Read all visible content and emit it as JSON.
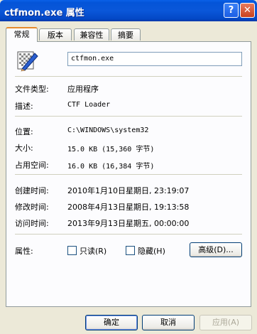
{
  "window": {
    "title": "ctfmon.exe 属性",
    "help_button": "?",
    "close_button": "✕"
  },
  "tabs": [
    {
      "label": "常规",
      "active": true
    },
    {
      "label": "版本",
      "active": false
    },
    {
      "label": "兼容性",
      "active": false
    },
    {
      "label": "摘要",
      "active": false
    }
  ],
  "general": {
    "file_icon": "executable-file-icon",
    "file_name": "ctfmon.exe",
    "rows_group1": [
      {
        "label": "文件类型:",
        "value": "应用程序"
      },
      {
        "label": "描述:",
        "value": "CTF Loader"
      }
    ],
    "rows_group2": [
      {
        "label": "位置:",
        "value": "C:\\WINDOWS\\system32"
      },
      {
        "label": "大小:",
        "value": "15.0 KB (15,360 字节)"
      },
      {
        "label": "占用空间:",
        "value": "16.0 KB (16,384 字节)"
      }
    ],
    "rows_group3": [
      {
        "label": "创建时间:",
        "value": "2010年1月10日星期日, 23:19:07"
      },
      {
        "label": "修改时间:",
        "value": "2008年4月13日星期日, 19:13:58"
      },
      {
        "label": "访问时间:",
        "value": "2013年9月13日星期五, 00:00:00"
      }
    ],
    "attributes": {
      "label": "属性:",
      "readonly": {
        "label": "只读(R)",
        "checked": false
      },
      "hidden": {
        "label": "隐藏(H)",
        "checked": false
      },
      "advanced_button": "高级(D)..."
    }
  },
  "footer": {
    "ok": "确定",
    "cancel": "取消",
    "apply": "应用(A)"
  }
}
